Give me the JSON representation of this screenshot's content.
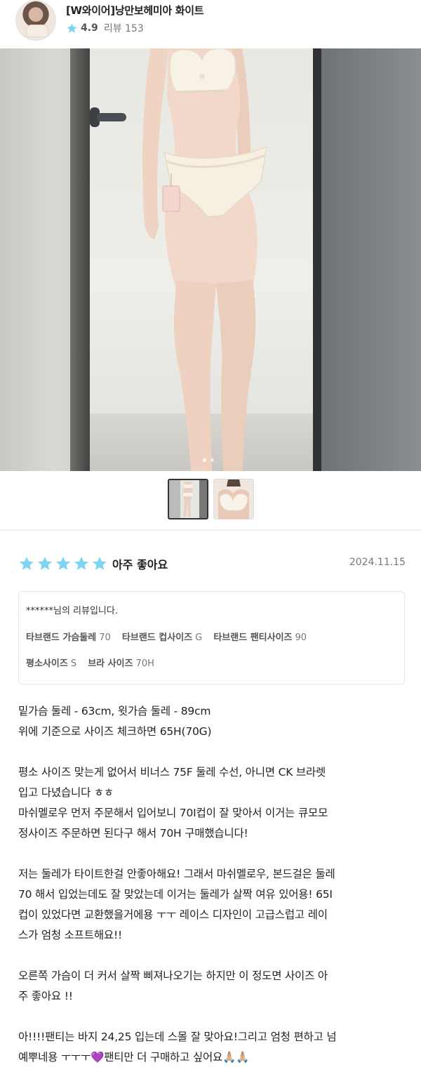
{
  "product": {
    "title": "[W와이어]낭만보헤미아 화이트",
    "rating": "4.9",
    "review_label": "리뷰 153",
    "star_color": "#7ed3ee"
  },
  "gallery": {
    "page_dots": 2,
    "active_dot": 1,
    "thumbnails": [
      "thumb-mirror-full-body",
      "thumb-bra-closeup"
    ]
  },
  "review": {
    "star_count": 5,
    "verdict": "아주 좋아요",
    "date": "2024.11.15",
    "reviewer_line": "******님의 리뷰입니다.",
    "specs_row1": [
      {
        "label": "타브랜드 가슴둘레",
        "value": "70"
      },
      {
        "label": "타브랜드 컵사이즈",
        "value": "G"
      },
      {
        "label": "타브랜드 팬티사이즈",
        "value": "90"
      }
    ],
    "specs_row2": [
      {
        "label": "평소사이즈",
        "value": "S"
      },
      {
        "label": "브라 사이즈",
        "value": "70H"
      }
    ],
    "paragraphs": [
      "밑가슴 둘레 - 63cm, 윗가슴 둘레 - 89cm\n위에 기준으로 사이즈 체크하면 65H(70G)",
      "평소 사이즈 맞는게 없어서 비너스 75F 둘레 수선, 아니면 CK 브라렛\n입고 다녔습니다 ㅎㅎ\n마쉬멜로우 먼저 주문해서 입어보니 70I컵이 잘 맞아서 이거는 큐모모\n정사이즈 주문하면 된다구 해서 70H 구매했습니다!",
      "저는 둘레가 타이트한걸 안좋아해요! 그래서 마쉬멜로우, 본드걸은 둘레\n70 해서 입었는데도 잘 맞았는데 이거는 둘레가 살짝 여유 있어용! 65I\n컵이 있었다면 교환했을거에용 ㅜㅜ 레이스 디자인이 고급스럽고 레이\n스가 엄청 소프트해요!!",
      "오른쪽 가슴이 더 커서 살짝 삐져나오기는 하지만 이 정도면 사이즈 아\n주 좋아요 !!",
      "아!!!!팬티는 바지 24,25 입는데 스몰 잘 맞아요!그리고 엄청 편하고 넘\n예뿌네용 ㅜㅜㅜ💜팬티만 더 구매하고 싶어요🙏🏼🙏🏼"
    ]
  }
}
